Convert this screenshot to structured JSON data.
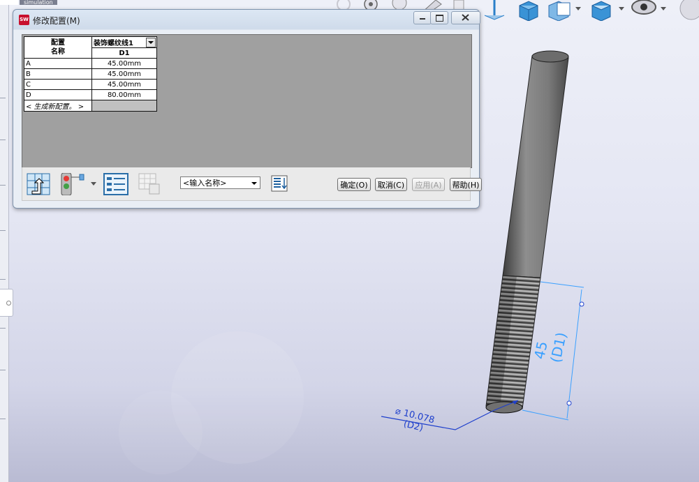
{
  "host": {
    "top_tabs": [
      "",
      "simulation"
    ]
  },
  "dialog": {
    "title": "修改配置(M)",
    "app_icon": "solidworks-logo",
    "table": {
      "name_header": "配置\n名称",
      "name_header_line1": "配置",
      "name_header_line2": "名称",
      "feature_header": "装饰螺纹线1",
      "dimension_header": "D1",
      "rows": [
        {
          "name": "A",
          "value": "45.00mm"
        },
        {
          "name": "B",
          "value": "45.00mm"
        },
        {
          "name": "C",
          "value": "45.00mm"
        },
        {
          "name": "D",
          "value": "80.00mm"
        }
      ],
      "new_config_label": "< 生成新配置。 >"
    },
    "name_input": {
      "value": "<输入名称>"
    },
    "buttons": {
      "ok": "确定(O)",
      "cancel": "取消(C)",
      "apply": "应用(A)",
      "help": "帮助(H)"
    }
  },
  "viewport": {
    "dimension_value": "45",
    "dimension_name": "(D1)",
    "diameter_value": "⌀ 10.078",
    "diameter_name": "(D2)",
    "dimension_color": "#3aa0ff",
    "diameter_color": "#1e3fcc"
  }
}
